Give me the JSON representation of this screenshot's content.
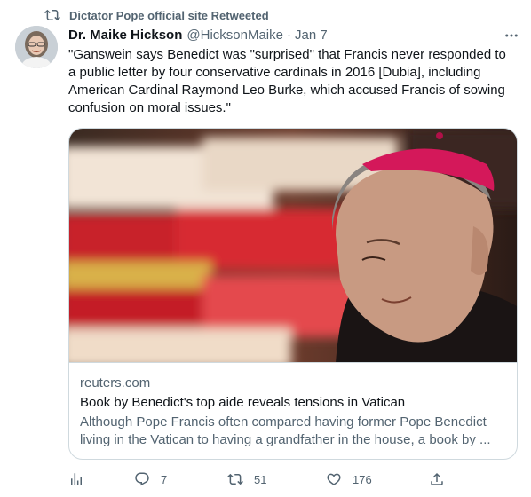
{
  "retweet": {
    "icon": "retweet-icon",
    "text": "Dictator Pope official site Retweeted"
  },
  "tweet": {
    "author_name": "Dr. Maike Hickson",
    "author_handle": "@HicksonMaike",
    "separator": "·",
    "date": "Jan 7",
    "text": "\"Ganswein says Benedict was \"surprised\" that Francis never responded to a public letter by four conservative cardinals in 2016 [Dubia], including American Cardinal Raymond Leo Burke, which accused Francis of sowing confusion on moral issues.\""
  },
  "card": {
    "domain": "reuters.com",
    "title": "Book by Benedict's top aide reveals tensions in Vatican",
    "description": "Although Pope Francis often compared having former Pope Benedict living in the Vatican to having a grandfather in the house, a book by ..."
  },
  "actions": {
    "analytics": {
      "icon": "analytics-icon"
    },
    "reply": {
      "icon": "reply-icon",
      "count": "7"
    },
    "retweet": {
      "icon": "retweet-icon",
      "count": "51"
    },
    "like": {
      "icon": "heart-icon",
      "count": "176"
    },
    "share": {
      "icon": "share-icon"
    }
  },
  "colors": {
    "text_primary": "#0f1419",
    "text_secondary": "#536471",
    "border": "#cfd9de"
  }
}
